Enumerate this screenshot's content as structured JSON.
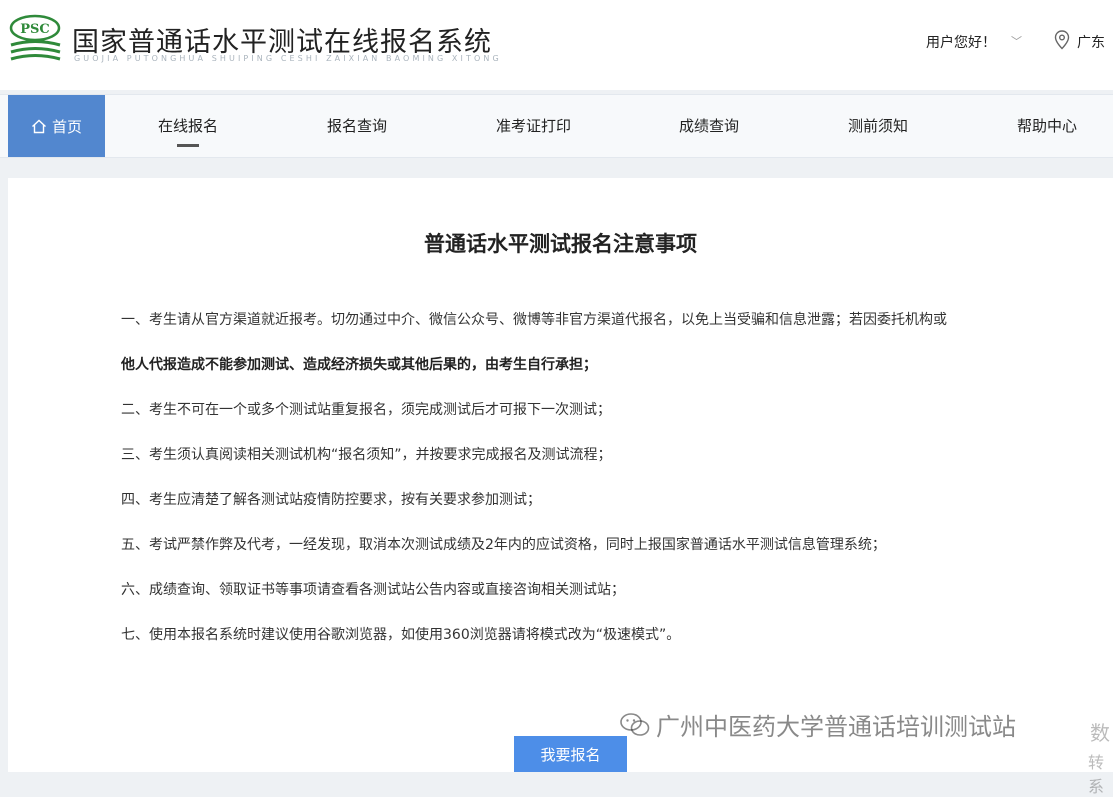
{
  "header": {
    "logo_text": "PSC",
    "title": "国家普通话水平测试在线报名系统",
    "subtitle": "GUOJIA PUTONGHUA SHUIPING CESHI ZAIXIAN BAOMING XITONG",
    "greeting": "用户您好！",
    "region": "广东"
  },
  "nav": {
    "home": "首页",
    "items": [
      "在线报名",
      "报名查询",
      "准考证打印",
      "成绩查询",
      "测前须知",
      "帮助中心"
    ]
  },
  "notice": {
    "title": "普通话水平测试报名注意事项",
    "rules": [
      "一、考生请从官方渠道就近报考。切勿通过中介、微信公众号、微博等非官方渠道代报名，以免上当受骗和信息泄露；若因委托机构或",
      "他人代报造成不能参加测试、造成经济损失或其他后果的，由考生自行承担；",
      "二、考生不可在一个或多个测试站重复报名，须完成测试后才可报下一次测试；",
      "三、考生须认真阅读相关测试机构“报名须知”，并按要求完成报名及测试流程；",
      "四、考生应清楚了解各测试站疫情防控要求，按有关要求参加测试；",
      "五、考试严禁作弊及代考，一经发现，取消本次测试成绩及2年内的应试资格，同时上报国家普通话水平测试信息管理系统；",
      "六、成绩查询、领取证书等事项请查看各测试站公告内容或直接咨询相关测试站；",
      "七、使用本报名系统时建议使用谷歌浏览器，如使用360浏览器请将模式改为“极速模式”。"
    ],
    "button": "我要报名"
  },
  "watermark": {
    "text": "广州中医药大学普通话培训测试站",
    "side1": "数",
    "side2": "转系"
  },
  "colors": {
    "accent": "#5287cf",
    "button": "#4d8ee8",
    "logo_green": "#2f8a3a"
  }
}
